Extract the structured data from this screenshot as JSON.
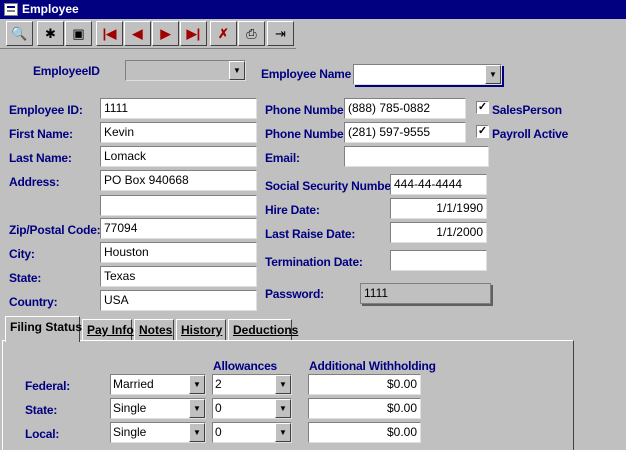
{
  "window": {
    "title": "Employee"
  },
  "toolbar": {
    "buttons": [
      {
        "name": "find-button",
        "icon": "binoculars-icon",
        "glyph": "🔭"
      },
      {
        "name": "new-record-button",
        "icon": "new-record-icon",
        "glyph": "✚"
      },
      {
        "name": "save-button",
        "icon": "floppy-disk-icon",
        "glyph": "💾"
      },
      {
        "name": "first-record-button",
        "icon": "first-record-icon",
        "glyph": "|◀"
      },
      {
        "name": "previous-record-button",
        "icon": "previous-record-icon",
        "glyph": "◀"
      },
      {
        "name": "next-record-button",
        "icon": "next-record-icon",
        "glyph": "▶"
      },
      {
        "name": "last-record-button",
        "icon": "last-record-icon",
        "glyph": "▶|"
      },
      {
        "name": "delete-record-button",
        "icon": "delete-record-icon",
        "glyph": "✗"
      },
      {
        "name": "print-button",
        "icon": "printer-icon",
        "glyph": "🖶"
      },
      {
        "name": "exit-button",
        "icon": "exit-door-icon",
        "glyph": "⇥"
      }
    ]
  },
  "lookup": {
    "employee_id_label": "EmployeeID",
    "employee_id_value": "",
    "employee_name_label": "Employee Name",
    "employee_name_value": ""
  },
  "form": {
    "employee_id_label": "Employee  ID:",
    "employee_id": "1111",
    "first_name_label": "First Name:",
    "first_name": "Kevin",
    "last_name_label": "Last Name:",
    "last_name": "Lomack",
    "address_label": "Address:",
    "address1": "PO Box 940668",
    "address2": "",
    "zip_label": "Zip/Postal Code:",
    "zip": "77094",
    "city_label": "City:",
    "city": "Houston",
    "state_label": "State:",
    "state": "Texas",
    "country_label": "Country:",
    "country": "USA",
    "phone1_label": "Phone Number:",
    "phone1": "(888) 785-0882",
    "phone2_label": "Phone Number:",
    "phone2": "(281) 597-9555",
    "email_label": "Email:",
    "email": "",
    "ssn_label": "Social Security Number:",
    "ssn": "444-44-4444",
    "hire_date_label": "Hire Date:",
    "hire_date": "1/1/1990",
    "last_raise_label": "Last Raise Date:",
    "last_raise": "1/1/2000",
    "termination_label": "Termination Date:",
    "termination": "",
    "password_label": "Password:",
    "password": "1111",
    "salesperson_label": "SalesPerson",
    "salesperson_checked": true,
    "payroll_label": "Payroll Active",
    "payroll_checked": true
  },
  "tabs": [
    {
      "label": "Filing Status",
      "active": true
    },
    {
      "label": "Pay Info",
      "active": false
    },
    {
      "label": "Notes",
      "active": false
    },
    {
      "label": "History",
      "active": false
    },
    {
      "label": "Deductions",
      "active": false
    }
  ],
  "filing": {
    "allowances_header": "Allowances",
    "withholding_header": "Additional Withholding",
    "rows": [
      {
        "label": "Federal:",
        "status": "Married",
        "allowances": "2",
        "withholding": "$0.00"
      },
      {
        "label": "State:",
        "status": "Single",
        "allowances": "0",
        "withholding": "$0.00"
      },
      {
        "label": "Local:",
        "status": "Single",
        "allowances": "0",
        "withholding": "$0.00"
      }
    ]
  },
  "colors": {
    "title_bar": "#000080",
    "label": "#000080",
    "face": "#c0c0c0"
  }
}
